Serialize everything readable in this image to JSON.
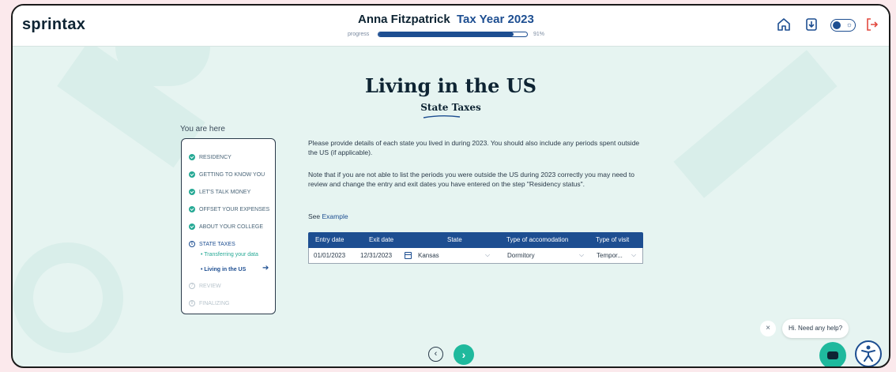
{
  "header": {
    "logo": "sprintax",
    "user_name": "Anna Fitzpatrick",
    "tax_year": "Tax Year 2023",
    "progress_label": "progress",
    "progress_percent": 91,
    "progress_text": "91%",
    "icons": [
      "home-icon",
      "download-icon",
      "theme-toggle",
      "logout-icon"
    ]
  },
  "page": {
    "title": "Living in the US",
    "subtitle": "State Taxes"
  },
  "sidebar": {
    "heading": "You are here",
    "steps": [
      {
        "label": "RESIDENCY",
        "status": "done"
      },
      {
        "label": "GETTING TO KNOW YOU",
        "status": "done"
      },
      {
        "label": "LET'S TALK MONEY",
        "status": "done"
      },
      {
        "label": "OFFSET YOUR EXPENSES",
        "status": "done"
      },
      {
        "label": "ABOUT YOUR COLLEGE",
        "status": "done"
      },
      {
        "label": "STATE TAXES",
        "status": "current",
        "number": "6"
      },
      {
        "label": "REVIEW",
        "status": "future",
        "number": "7"
      },
      {
        "label": "FINALIZING",
        "status": "future",
        "number": "8"
      }
    ],
    "substeps": [
      {
        "label": "• Transferring your data",
        "active": false
      },
      {
        "label": "• Living in the US",
        "active": true
      }
    ]
  },
  "content": {
    "para1": "Please provide details of each state you lived in during 2023. You should also include any periods spent outside the US (if applicable).",
    "para2": "Note that if you are not able to list the periods you were outside the US during 2023 correctly you may need to review and change the entry and exit dates you have entered on the step \"Residency status\".",
    "see_prefix": "See",
    "see_link": "Example"
  },
  "table": {
    "headers": [
      "Entry date",
      "Exit date",
      "State",
      "Type of accomodation",
      "Type of visit"
    ],
    "rows": [
      {
        "entry_date": "01/01/2023",
        "exit_date": "12/31/2023",
        "state": "Kansas",
        "accomodation": "Dormitory",
        "visit": "Tempor..."
      }
    ]
  },
  "nav": {
    "prev": "‹",
    "next": "›"
  },
  "help": {
    "close": "×",
    "bubble": "Hi. Need any help?"
  },
  "colors": {
    "accent": "#1d4e91",
    "teal": "#1fb99d",
    "background": "#e6f4f1"
  }
}
